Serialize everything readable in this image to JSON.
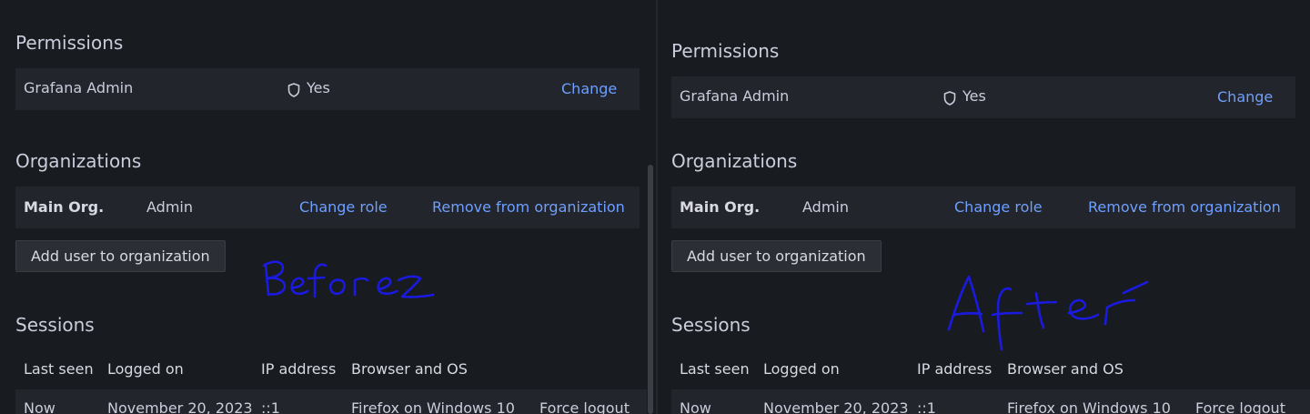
{
  "before": {
    "permissions": {
      "title": "Permissions",
      "row": {
        "label": "Grafana Admin",
        "value": "Yes",
        "action": "Change"
      }
    },
    "organizations": {
      "title": "Organizations",
      "row": {
        "name": "Main Org.",
        "role": "Admin",
        "change_role": "Change role",
        "remove": "Remove from organization"
      },
      "add_button": "Add user to organization"
    },
    "sessions": {
      "title": "Sessions",
      "headers": [
        "Last seen",
        "Logged on",
        "IP address",
        "Browser and OS"
      ],
      "row": {
        "last_seen": "Now",
        "logged_on": "November 20, 2023",
        "ip": "::1",
        "browser": "Firefox on Windows 10",
        "action": "Force logout"
      }
    }
  },
  "after": {
    "permissions": {
      "title": "Permissions",
      "row": {
        "label": "Grafana Admin",
        "value": "Yes",
        "action": "Change"
      }
    },
    "organizations": {
      "title": "Organizations",
      "row": {
        "name": "Main Org.",
        "role": "Admin",
        "change_role": "Change role",
        "remove": "Remove from organization"
      },
      "add_button": "Add user to organization"
    },
    "sessions": {
      "title": "Sessions",
      "headers": [
        "Last seen",
        "Logged on",
        "IP address",
        "Browser and OS"
      ],
      "row": {
        "last_seen": "Now",
        "logged_on": "November 20, 2023",
        "ip": "::1",
        "browser": "Firefox on Windows 10",
        "action": "Force logout"
      }
    }
  },
  "annotations": {
    "before_label": "Before",
    "after_label": "After",
    "ink_color": "#1a1ae0"
  },
  "colors": {
    "background": "#181b1f",
    "row_background": "#22252b",
    "link": "#6e9fff",
    "text": "#ccccdc"
  },
  "icons": {
    "admin_shield": "shield-icon"
  }
}
